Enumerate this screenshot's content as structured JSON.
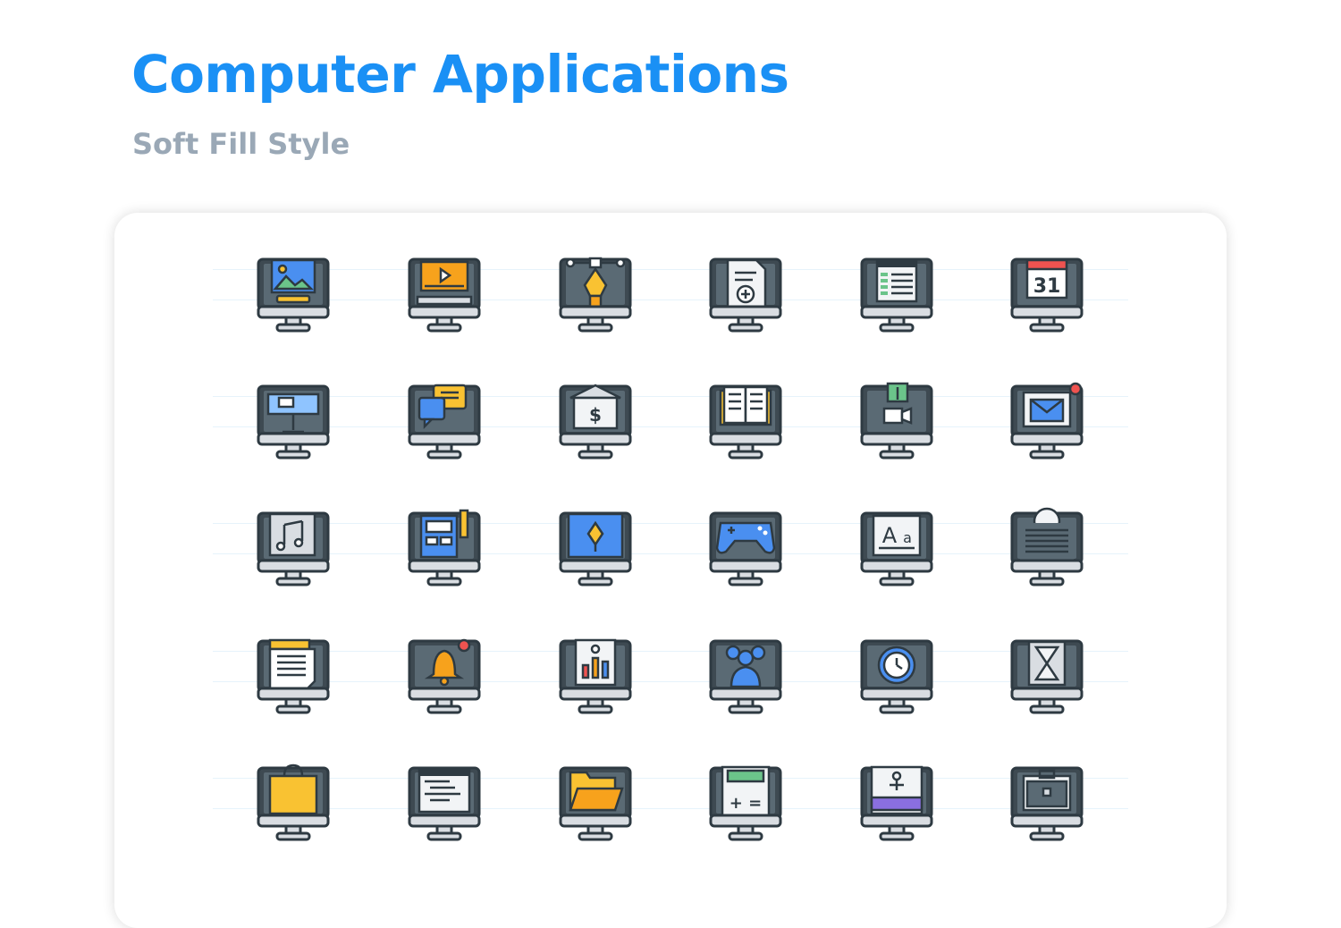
{
  "header": {
    "title": "Computer Applications",
    "subtitle": "Soft Fill Style"
  },
  "colors": {
    "title": "#1a90f5",
    "subtitle": "#9aa8b6",
    "monitor_frame": "#3e4a52",
    "screen": "#5a6a74",
    "stand": "#d9dde2",
    "outline": "#2e3a42",
    "accent_blue": "#4a8ff0",
    "accent_yellow": "#f9c232",
    "accent_orange": "#f7a21c",
    "accent_green": "#6bc48a",
    "accent_red": "#ef5350",
    "accent_purple": "#8a6fe0",
    "paper": "#f2f4f6"
  },
  "icons": [
    {
      "name": "image-editor-icon",
      "calendar_day": ""
    },
    {
      "name": "video-player-icon",
      "calendar_day": ""
    },
    {
      "name": "pen-tool-icon",
      "calendar_day": ""
    },
    {
      "name": "add-document-icon",
      "calendar_day": ""
    },
    {
      "name": "spreadsheet-icon",
      "calendar_day": ""
    },
    {
      "name": "calendar-icon",
      "calendar_day": "31"
    },
    {
      "name": "presentation-icon",
      "calendar_day": ""
    },
    {
      "name": "chat-icon",
      "calendar_day": ""
    },
    {
      "name": "bank-icon",
      "calendar_day": ""
    },
    {
      "name": "ebook-icon",
      "calendar_day": ""
    },
    {
      "name": "video-upload-icon",
      "calendar_day": ""
    },
    {
      "name": "email-icon",
      "calendar_day": ""
    },
    {
      "name": "music-icon",
      "calendar_day": ""
    },
    {
      "name": "design-tools-icon",
      "calendar_day": ""
    },
    {
      "name": "blueprint-icon",
      "calendar_day": ""
    },
    {
      "name": "gamepad-icon",
      "calendar_day": ""
    },
    {
      "name": "font-icon",
      "calendar_day": ""
    },
    {
      "name": "settings-icon",
      "calendar_day": ""
    },
    {
      "name": "notes-icon",
      "calendar_day": ""
    },
    {
      "name": "notification-bell-icon",
      "calendar_day": ""
    },
    {
      "name": "analytics-icon",
      "calendar_day": ""
    },
    {
      "name": "group-users-icon",
      "calendar_day": ""
    },
    {
      "name": "alarm-clock-icon",
      "calendar_day": ""
    },
    {
      "name": "hourglass-icon",
      "calendar_day": ""
    },
    {
      "name": "shopping-bag-icon",
      "calendar_day": ""
    },
    {
      "name": "code-editor-icon",
      "calendar_day": ""
    },
    {
      "name": "folder-icon",
      "calendar_day": ""
    },
    {
      "name": "calculator-icon",
      "calendar_day": ""
    },
    {
      "name": "tutorial-icon",
      "calendar_day": ""
    },
    {
      "name": "briefcase-icon",
      "calendar_day": ""
    }
  ]
}
